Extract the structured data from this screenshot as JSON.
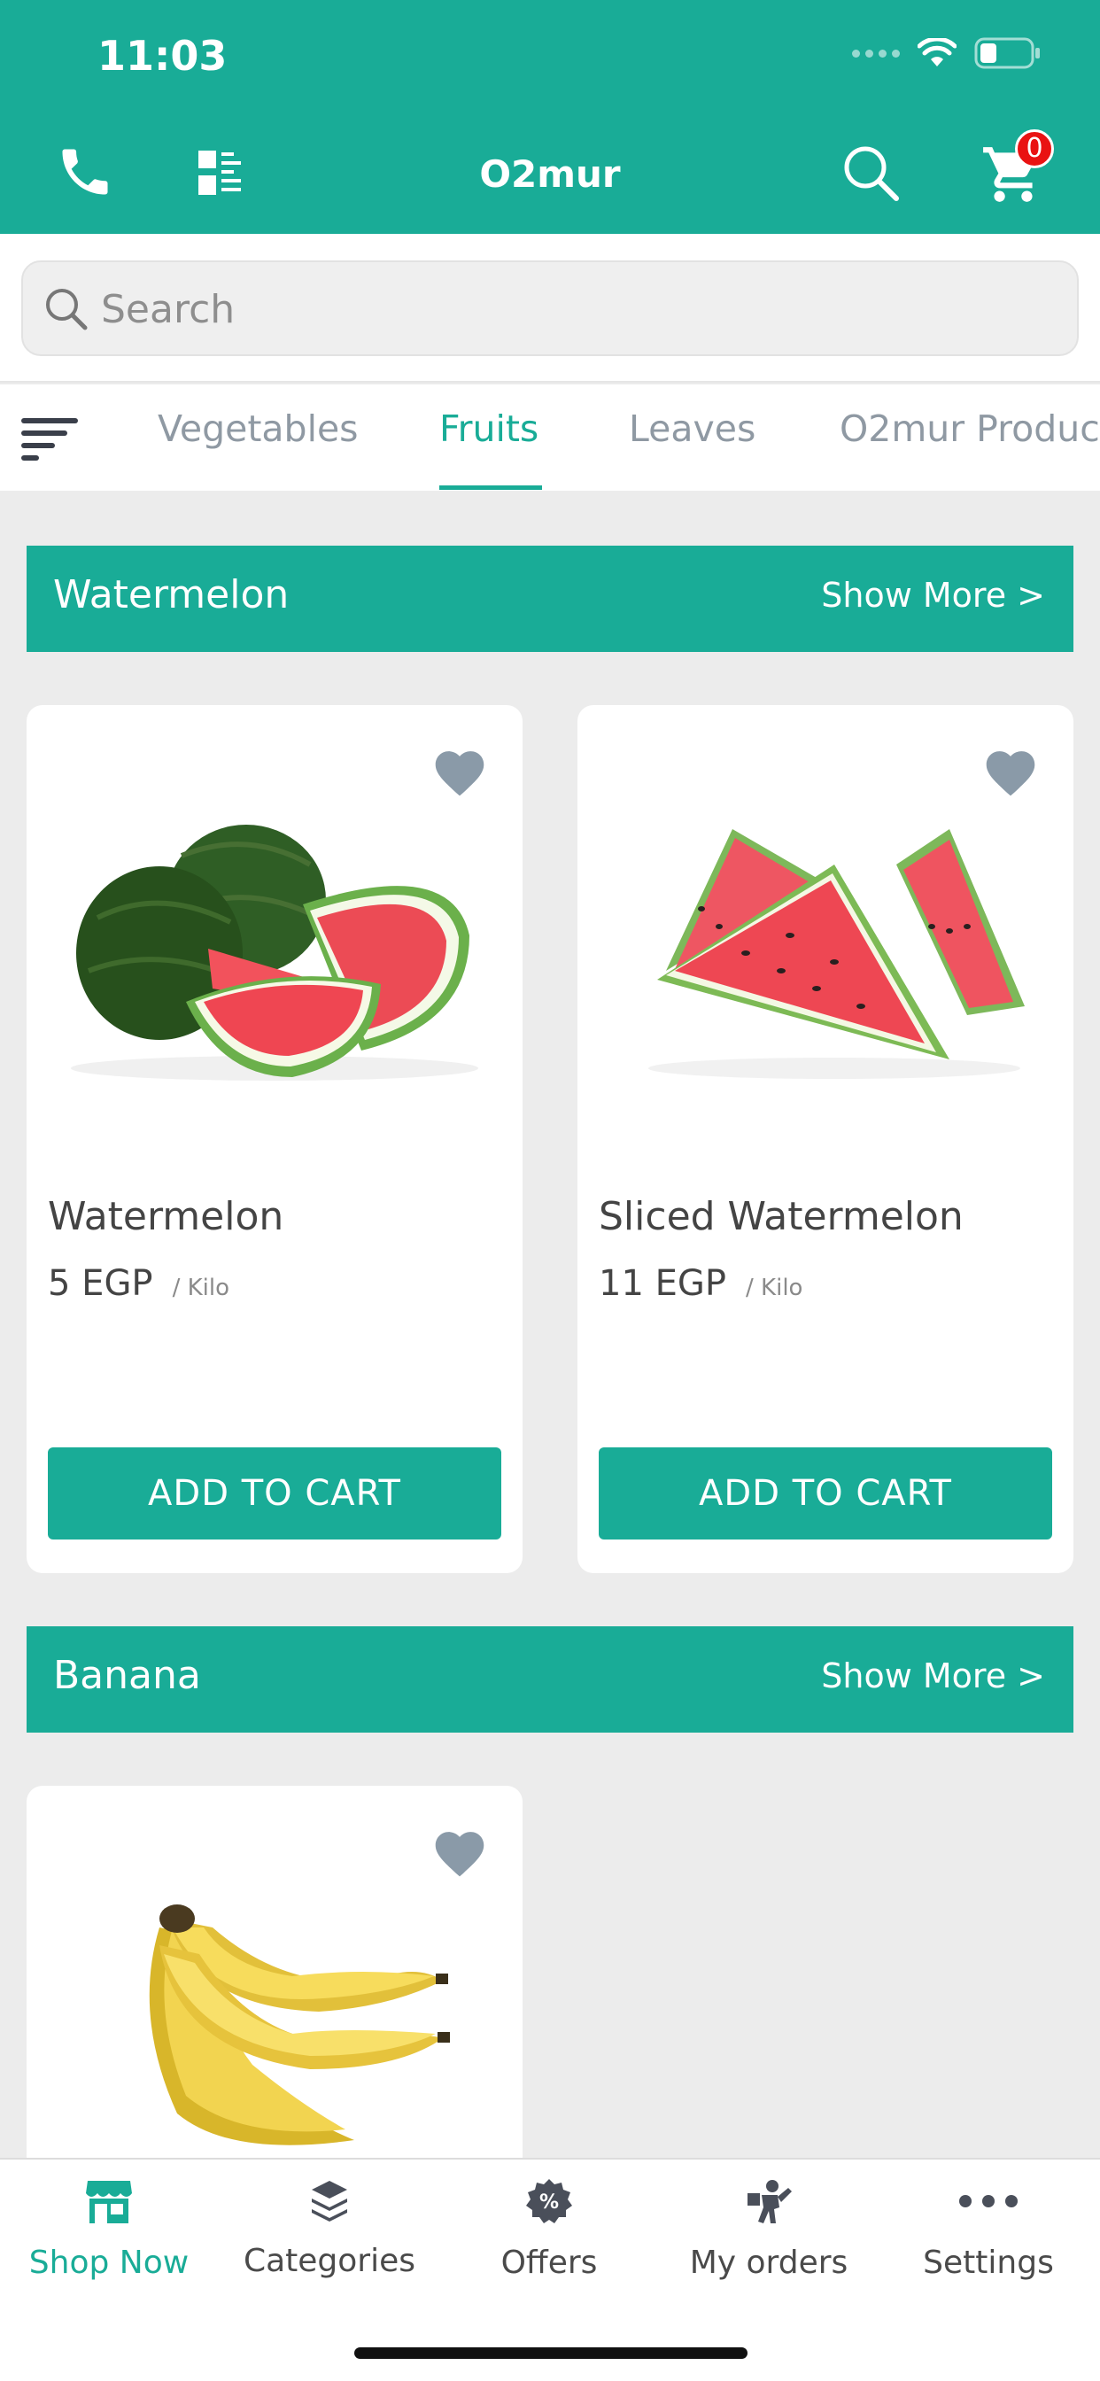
{
  "status_bar": {
    "time": "11:03"
  },
  "header": {
    "title": "O2mur",
    "cart_count": "0"
  },
  "search": {
    "placeholder": "Search",
    "value": ""
  },
  "tabs": [
    {
      "label": "Vegetables",
      "active": false
    },
    {
      "label": "Fruits",
      "active": true
    },
    {
      "label": "Leaves",
      "active": false
    },
    {
      "label": "O2mur Produc",
      "active": false
    }
  ],
  "sections": [
    {
      "title": "Watermelon",
      "show_more": "Show More >",
      "products": [
        {
          "name": "Watermelon",
          "price": "5 EGP",
          "unit": "/ Kilo",
          "button": "ADD TO CART"
        },
        {
          "name": "Sliced Watermelon",
          "price": "11 EGP",
          "unit": "/ Kilo",
          "button": "ADD TO CART"
        }
      ]
    },
    {
      "title": "Banana",
      "show_more": "Show More >",
      "products": [
        {
          "name": "",
          "price": "",
          "unit": "",
          "button": ""
        }
      ]
    }
  ],
  "bottom_nav": [
    {
      "label": "Shop Now",
      "icon": "store-icon",
      "active": true
    },
    {
      "label": "Categories",
      "icon": "layers-icon",
      "active": false
    },
    {
      "label": "Offers",
      "icon": "percent-badge-icon",
      "active": false
    },
    {
      "label": "My orders",
      "icon": "delivery-person-icon",
      "active": false
    },
    {
      "label": "Settings",
      "icon": "more-dots-icon",
      "active": false
    }
  ],
  "colors": {
    "brand": "#19ac97",
    "badge": "#e91212",
    "heart": "#8a9aa8",
    "background": "#ececec"
  }
}
